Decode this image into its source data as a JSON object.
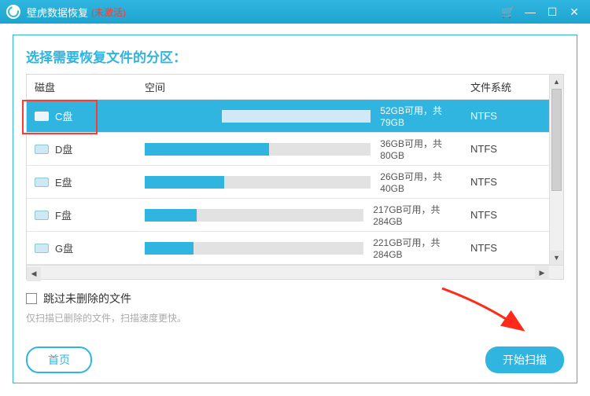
{
  "titlebar": {
    "app_name": "壁虎数据恢复",
    "not_activated": "(未激活)"
  },
  "heading": "选择需要恢复文件的分区：",
  "columns": {
    "disk": "磁盘",
    "space": "空间",
    "fs": "文件系统"
  },
  "rows": [
    {
      "name": "C盘",
      "free": 52,
      "total": 79,
      "space_text": "52GB可用，共79GB",
      "fs": "NTFS",
      "selected": true,
      "highlighted": true
    },
    {
      "name": "D盘",
      "free": 36,
      "total": 80,
      "space_text": "36GB可用，共80GB",
      "fs": "NTFS",
      "selected": false
    },
    {
      "name": "E盘",
      "free": 26,
      "total": 40,
      "space_text": "26GB可用，共40GB",
      "fs": "NTFS",
      "selected": false
    },
    {
      "name": "F盘",
      "free": 217,
      "total": 284,
      "space_text": "217GB可用，共284GB",
      "fs": "NTFS",
      "selected": false
    },
    {
      "name": "G盘",
      "free": 221,
      "total": 284,
      "space_text": "221GB可用，共284GB",
      "fs": "NTFS",
      "selected": false
    }
  ],
  "skip": {
    "label": "跳过未删除的文件",
    "hint": "仅扫描已删除的文件，扫描速度更快。"
  },
  "buttons": {
    "home": "首页",
    "scan": "开始扫描"
  }
}
